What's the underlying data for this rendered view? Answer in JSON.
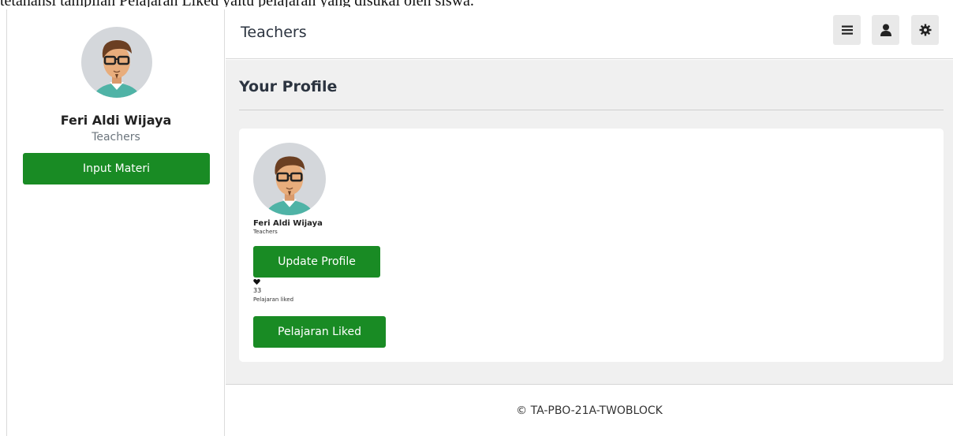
{
  "doc_strip": {
    "text": "tetanansi tampilan Pelajaran Liked yaitu pelajaran yang disukai oleh siswa."
  },
  "sidebar": {
    "name": "Feri Aldi Wijaya",
    "role": "Teachers",
    "input_button": "Input Materi",
    "avatar_icon": "user-avatar"
  },
  "topbar": {
    "title": "Teachers",
    "menu_icon": "menu-icon",
    "user_icon": "user-icon",
    "settings_icon": "gear-icon"
  },
  "main": {
    "title": "Your Profile",
    "card": {
      "name": "Feri Aldi Wijaya",
      "role": "Teachers",
      "update_button": "Update Profile",
      "heart_icon": "heart-icon",
      "liked_count": "33",
      "liked_label": "Pelajaran liked",
      "liked_button": "Pelajaran Liked"
    }
  },
  "footer": {
    "text": "© TA-PBO-21A-TWOBLOCK"
  },
  "colors": {
    "primary_green": "#198b24",
    "content_bg": "#f0f0f0",
    "icon_btn_bg": "#e9e9e9"
  }
}
